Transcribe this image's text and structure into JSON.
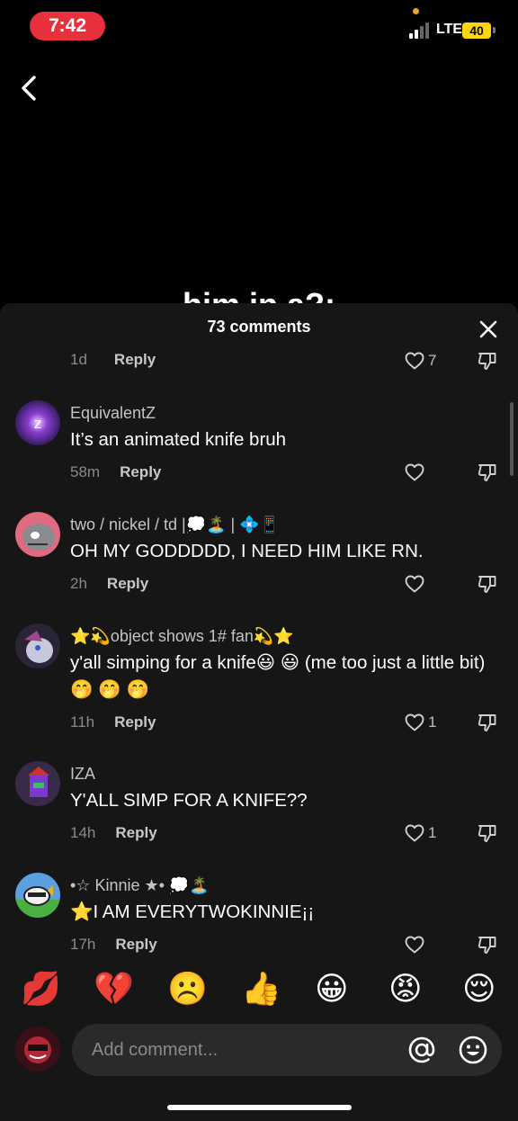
{
  "status_bar": {
    "time": "7:42",
    "network": "LTE",
    "battery": "40"
  },
  "video": {
    "caption": "him in a?:"
  },
  "comments_sheet": {
    "title": "73 comments",
    "previous": {
      "time": "1d",
      "reply_label": "Reply",
      "likes": "7"
    },
    "comments": [
      {
        "username": "EquivalentZ",
        "text": "It’s an animated knife bruh",
        "time": "58m",
        "reply_label": "Reply",
        "likes": ""
      },
      {
        "username": "two / nickel / td |💭🏝️ | 💠📱",
        "text": "OH MY GODDDDD, I NEED HIM LIKE RN.",
        "time": "2h",
        "reply_label": "Reply",
        "likes": ""
      },
      {
        "username": "⭐💫object shows 1# fan💫⭐",
        "text": "y'all simping for a knife😃 😃  (me too just a little bit) 🤭 🤭 🤭",
        "time": "11h",
        "reply_label": "Reply",
        "likes": "1"
      },
      {
        "username": "IZA",
        "text": "Y'ALL SIMP FOR A KNIFE??",
        "time": "14h",
        "reply_label": "Reply",
        "likes": "1"
      },
      {
        "username": "•☆ Kinnie ★• 💭🏝️",
        "text": "⭐I AM EVERYTWOKINNIE¡¡",
        "time": "17h",
        "reply_label": "Reply",
        "likes": ""
      }
    ]
  },
  "quick_emojis": [
    "💋",
    "💔",
    "☹️",
    "👍",
    "😀",
    "😡",
    "😌"
  ],
  "input": {
    "placeholder": "Add comment..."
  },
  "colors": {
    "sheet": "#161616",
    "input": "#2a2a2a",
    "time_pill": "#e8313c",
    "battery": "#ffd60a"
  }
}
